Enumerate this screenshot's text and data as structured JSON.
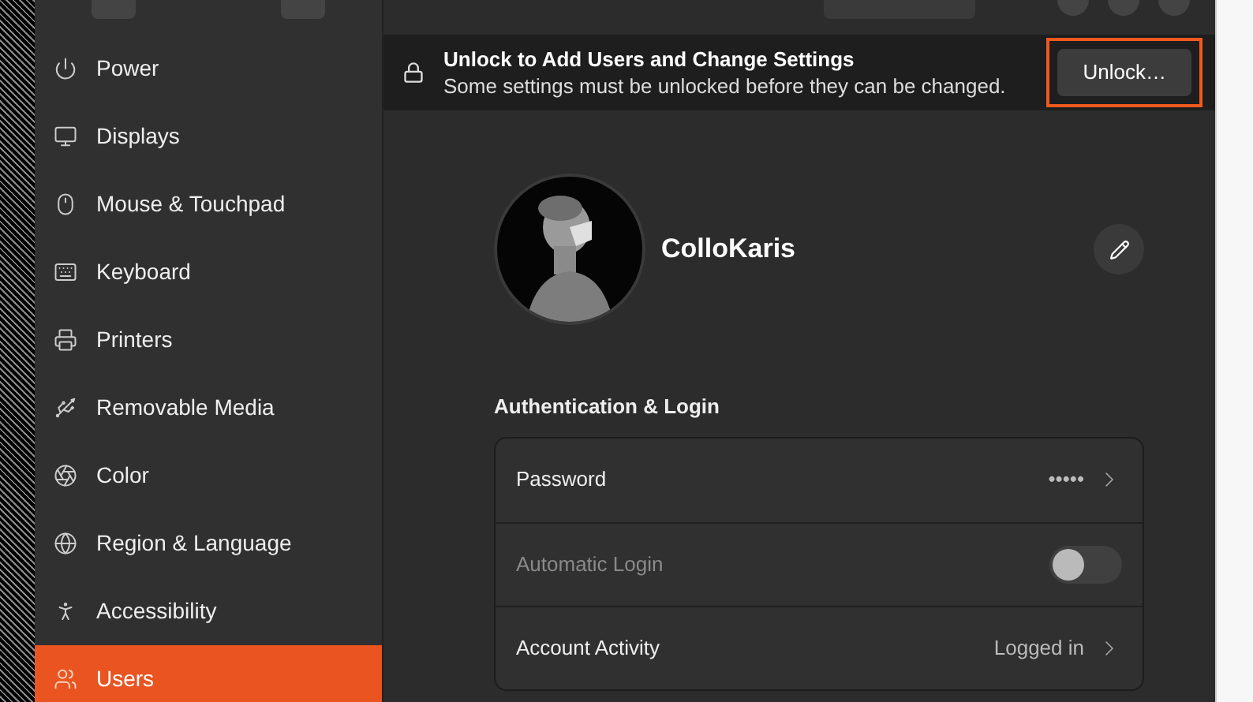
{
  "sidebar": {
    "items": [
      {
        "label": "Power",
        "selected": false
      },
      {
        "label": "Displays",
        "selected": false
      },
      {
        "label": "Mouse & Touchpad",
        "selected": false
      },
      {
        "label": "Keyboard",
        "selected": false
      },
      {
        "label": "Printers",
        "selected": false
      },
      {
        "label": "Removable Media",
        "selected": false
      },
      {
        "label": "Color",
        "selected": false
      },
      {
        "label": "Region & Language",
        "selected": false
      },
      {
        "label": "Accessibility",
        "selected": false
      },
      {
        "label": "Users",
        "selected": true
      }
    ]
  },
  "banner": {
    "title": "Unlock to Add Users and Change Settings",
    "subtitle": "Some settings must be unlocked before they can be changed.",
    "button": "Unlock…",
    "highlighted": true
  },
  "user": {
    "name": "ColloKaris"
  },
  "auth": {
    "heading": "Authentication & Login",
    "rows": [
      {
        "kind": "link",
        "label": "Password",
        "value": "•••••",
        "disabled": false
      },
      {
        "kind": "switch",
        "label": "Automatic Login",
        "on": false,
        "disabled": true
      },
      {
        "kind": "link",
        "label": "Account Activity",
        "value": "Logged in",
        "disabled": false
      }
    ]
  }
}
